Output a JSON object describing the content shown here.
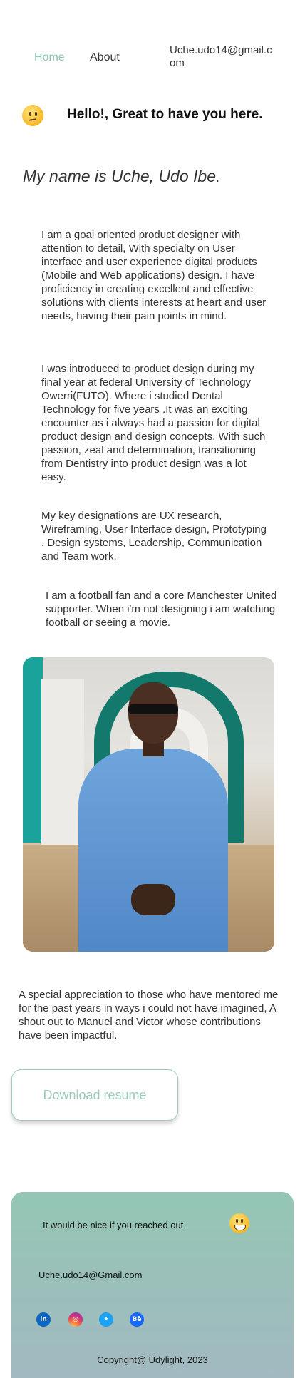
{
  "nav": {
    "home": "Home",
    "about": "About",
    "email": "Uche.udo14@gmail.com"
  },
  "greeting": {
    "icon": "slightly-smiling-face-icon",
    "text": "Hello!, Great to have you here."
  },
  "name_heading": "My name is Uche, Udo Ibe.",
  "paragraphs": [
    "I am a goal oriented product designer with attention to detail, With specialty on User interface and user experience digital products (Mobile and Web applications) design. I have proficiency in creating excellent and effective solutions with clients interests at heart and user needs, having their pain points in mind.",
    "I was introduced to product design during my final year at federal University of Technology Owerri(FUTO). Where i studied Dental Technology for five years .It was an exciting encounter as i always had a passion for digital product design and design concepts. With such passion, zeal and determination, transitioning from Dentistry into product design was a lot easy.",
    "My key designations are UX research, Wireframing, User Interface design, Prototyping , Design systems, Leadership, Communication and Team work.",
    "I am a football fan and a core Manchester United supporter. When i'm not designing i am watching football or seeing a movie."
  ],
  "thanks": "A special appreciation to those who have mentored me for the past years in ways i could not have imagined, A shout out to Manuel and Victor whose contributions have been impactful.",
  "download_button": "Download resume",
  "footer": {
    "reach_text": "It would be nice if you reached out",
    "reach_icon": "grinning-face-icon",
    "email": "Uche.udo14@Gmail.com",
    "socials": [
      {
        "name": "linkedin-icon",
        "glyph": "in"
      },
      {
        "name": "instagram-icon",
        "glyph": "◎"
      },
      {
        "name": "twitter-icon",
        "glyph": "✦"
      },
      {
        "name": "behance-icon",
        "glyph": "Bē"
      }
    ],
    "copyright": "Copyright@ Udylight, 2023"
  },
  "colors": {
    "accent": "#8cc7b4",
    "footer_top": "#94c6b3",
    "footer_bottom": "#a2b9c1"
  }
}
